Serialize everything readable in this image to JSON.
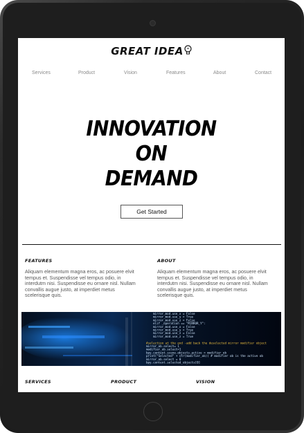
{
  "logo": {
    "text": "GREAT IDEA"
  },
  "nav": {
    "items": [
      "Services",
      "Product",
      "Vision",
      "Features",
      "About",
      "Contact"
    ]
  },
  "hero": {
    "lines": [
      "INNOVATION",
      "ON",
      "DEMAND"
    ]
  },
  "cta": {
    "label": "Get Started"
  },
  "features": {
    "title": "FEATURES",
    "lines": [
      "Aliquam elementum magna eros, ac posuere elvit",
      "tempus et. Suspendisse vel tempus odio, in",
      "interdutm nisi. Suspendisse eu ornare nisl. Nullam",
      "convallis augue justo, at imperdiet metus",
      "scelerisque quis."
    ]
  },
  "about": {
    "title": "ABOUT",
    "lines": [
      "Aliquam elementum magna eros, ac posuere elvit",
      "tempus et. Suspendisse vel tempus odio, in",
      "interdutm nisi. Suspendisse eu ornare nisl. Nullam",
      "convallis augue justo, at imperdiet metus",
      "scelerisque quis."
    ]
  },
  "code_image": {
    "lines": [
      "mirror_mod.use_x = False",
      "mirror_mod.use_y = True",
      "mirror_mod.use_z = False",
      "elif _operation == \"MIRROR_Y\":",
      "mirror_mod.use_x = False",
      "mirror_mod.use_y = True",
      "mirror_mod.use_z = False",
      "mirror_mod.use_z = True",
      "",
      "#selection at the end -add back the deselected mirror modifier object",
      "mirror_ob.select= 1",
      "modifier_ob.select=1",
      "bpy.context.scene.objects.active = modifier_ob",
      "print(\"Selected\" + str(modifier_ob)) # modifier ob is the active ob",
      "mirror_ob.select = 0",
      "bpy.context.selected_objects[0]"
    ]
  },
  "bottom_sections": [
    {
      "title": "SERVICES"
    },
    {
      "title": "PRODUCT"
    },
    {
      "title": "VISION"
    }
  ]
}
